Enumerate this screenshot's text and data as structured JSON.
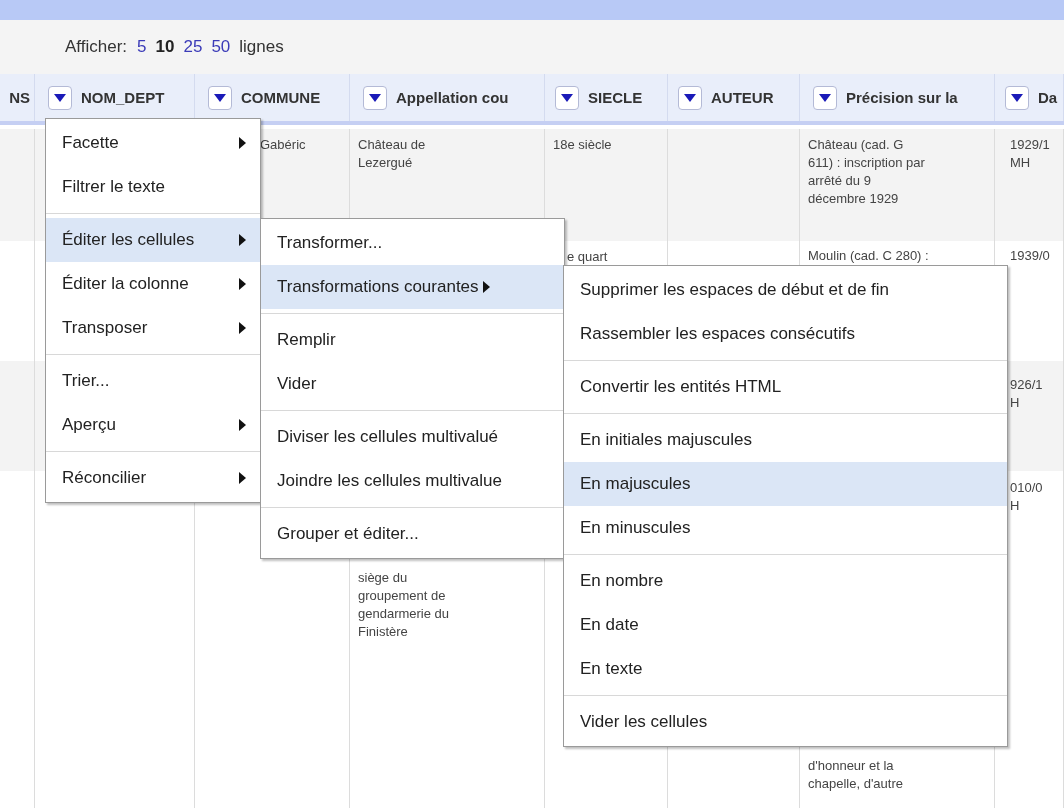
{
  "pager": {
    "label": "Afficher:",
    "options": [
      {
        "text": "5",
        "selected": false
      },
      {
        "text": "10",
        "selected": true
      },
      {
        "text": "25",
        "selected": false
      },
      {
        "text": "50",
        "selected": false
      }
    ],
    "suffix": "lignes"
  },
  "table": {
    "columns": [
      {
        "label": "NS",
        "menu_button": false
      },
      {
        "label": "NOM_DEPT",
        "menu_button": true
      },
      {
        "label": "COMMUNE",
        "menu_button": true
      },
      {
        "label": "Appellation cou",
        "menu_button": true
      },
      {
        "label": "SIECLE",
        "menu_button": true
      },
      {
        "label": "AUTEUR",
        "menu_button": true
      },
      {
        "label": "Précision sur la",
        "menu_button": true
      },
      {
        "label": "Da",
        "menu_button": true
      }
    ],
    "rows": [
      {
        "cells": [
          null,
          null,
          [
            "Gabéric"
          ],
          [
            "Château de",
            "Lezergué"
          ],
          [
            "18e siècle"
          ],
          null,
          [
            "Château (cad. G",
            "611) : inscription par",
            "arrêté du 9",
            "décembre 1929"
          ],
          [
            "1929/1",
            "MH"
          ]
        ]
      },
      {
        "cells": [
          null,
          null,
          null,
          null,
          [
            "e quart"
          ],
          null,
          [
            "Moulin (cad. C 280) :"
          ],
          [
            "1939/0"
          ]
        ]
      },
      {
        "cells": [
          null,
          null,
          null,
          null,
          null,
          null,
          null,
          [
            "926/1",
            "H"
          ]
        ]
      },
      {
        "cells": [
          null,
          null,
          null,
          [
            "siège du",
            "groupement de",
            "gendarmerie du",
            "Finistère"
          ],
          null,
          null,
          [
            "d'honneur et la",
            "chapelle, d'autre"
          ],
          [
            "010/0",
            "H"
          ]
        ]
      }
    ]
  },
  "menus": [
    {
      "groups": [
        [
          {
            "label": "Facette",
            "submenu": true,
            "selected": false
          },
          {
            "label": "Filtrer le texte",
            "submenu": false,
            "selected": false
          }
        ],
        [
          {
            "label": "Éditer les cellules",
            "submenu": true,
            "selected": true
          },
          {
            "label": "Éditer la colonne",
            "submenu": true,
            "selected": false
          },
          {
            "label": "Transposer",
            "submenu": true,
            "selected": false
          }
        ],
        [
          {
            "label": "Trier...",
            "submenu": false,
            "selected": false
          },
          {
            "label": "Aperçu",
            "submenu": true,
            "selected": false
          }
        ],
        [
          {
            "label": "Réconcilier",
            "submenu": true,
            "selected": false
          }
        ]
      ]
    },
    {
      "groups": [
        [
          {
            "label": "Transformer...",
            "submenu": false,
            "selected": false
          },
          {
            "label": "Transformations courantes",
            "submenu": true,
            "selected": true
          }
        ],
        [
          {
            "label": "Remplir",
            "submenu": false,
            "selected": false
          },
          {
            "label": "Vider",
            "submenu": false,
            "selected": false
          }
        ],
        [
          {
            "label": "Diviser les cellules multivalué",
            "submenu": false,
            "selected": false
          },
          {
            "label": "Joindre les cellules multivalue",
            "submenu": false,
            "selected": false
          }
        ],
        [
          {
            "label": "Grouper et éditer...",
            "submenu": false,
            "selected": false
          }
        ]
      ]
    },
    {
      "groups": [
        [
          {
            "label": "Supprimer les espaces de début et de fin",
            "submenu": false,
            "selected": false
          },
          {
            "label": "Rassembler les espaces consécutifs",
            "submenu": false,
            "selected": false
          }
        ],
        [
          {
            "label": "Convertir les entités HTML",
            "submenu": false,
            "selected": false
          }
        ],
        [
          {
            "label": "En initiales majuscules",
            "submenu": false,
            "selected": false
          },
          {
            "label": "En majuscules",
            "submenu": false,
            "selected": true
          },
          {
            "label": "En minuscules",
            "submenu": false,
            "selected": false
          }
        ],
        [
          {
            "label": "En nombre",
            "submenu": false,
            "selected": false
          },
          {
            "label": "En date",
            "submenu": false,
            "selected": false
          },
          {
            "label": "En texte",
            "submenu": false,
            "selected": false
          }
        ],
        [
          {
            "label": "Vider les cellules",
            "submenu": false,
            "selected": false
          }
        ]
      ]
    }
  ]
}
